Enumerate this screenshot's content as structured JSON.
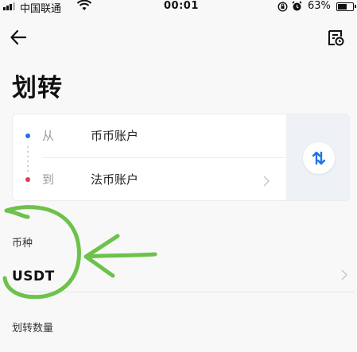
{
  "status_bar": {
    "carrier": "中国联通",
    "time": "00:01",
    "battery_percent": "63%",
    "battery_level": 0.63,
    "icons": [
      "signal-icon",
      "wifi-icon",
      "rotation-lock-icon",
      "alarm-icon",
      "battery-icon"
    ]
  },
  "nav": {
    "back_icon": "arrow-left-icon",
    "record_icon": "transfer-record-icon"
  },
  "page": {
    "title": "划转"
  },
  "transfer": {
    "from_label": "从",
    "from_account": "币币账户",
    "to_label": "到",
    "to_account": "法币账户",
    "swap_icon": "swap-arrows-icon",
    "colors": {
      "from_dot": "#1e74e8",
      "to_dot": "#e0395c",
      "swap_icon": "#1e74e8"
    }
  },
  "currency": {
    "label": "币种",
    "value": "USDT"
  },
  "amount": {
    "label": "划转数量"
  },
  "annotation": {
    "color": "#6cc24a"
  }
}
